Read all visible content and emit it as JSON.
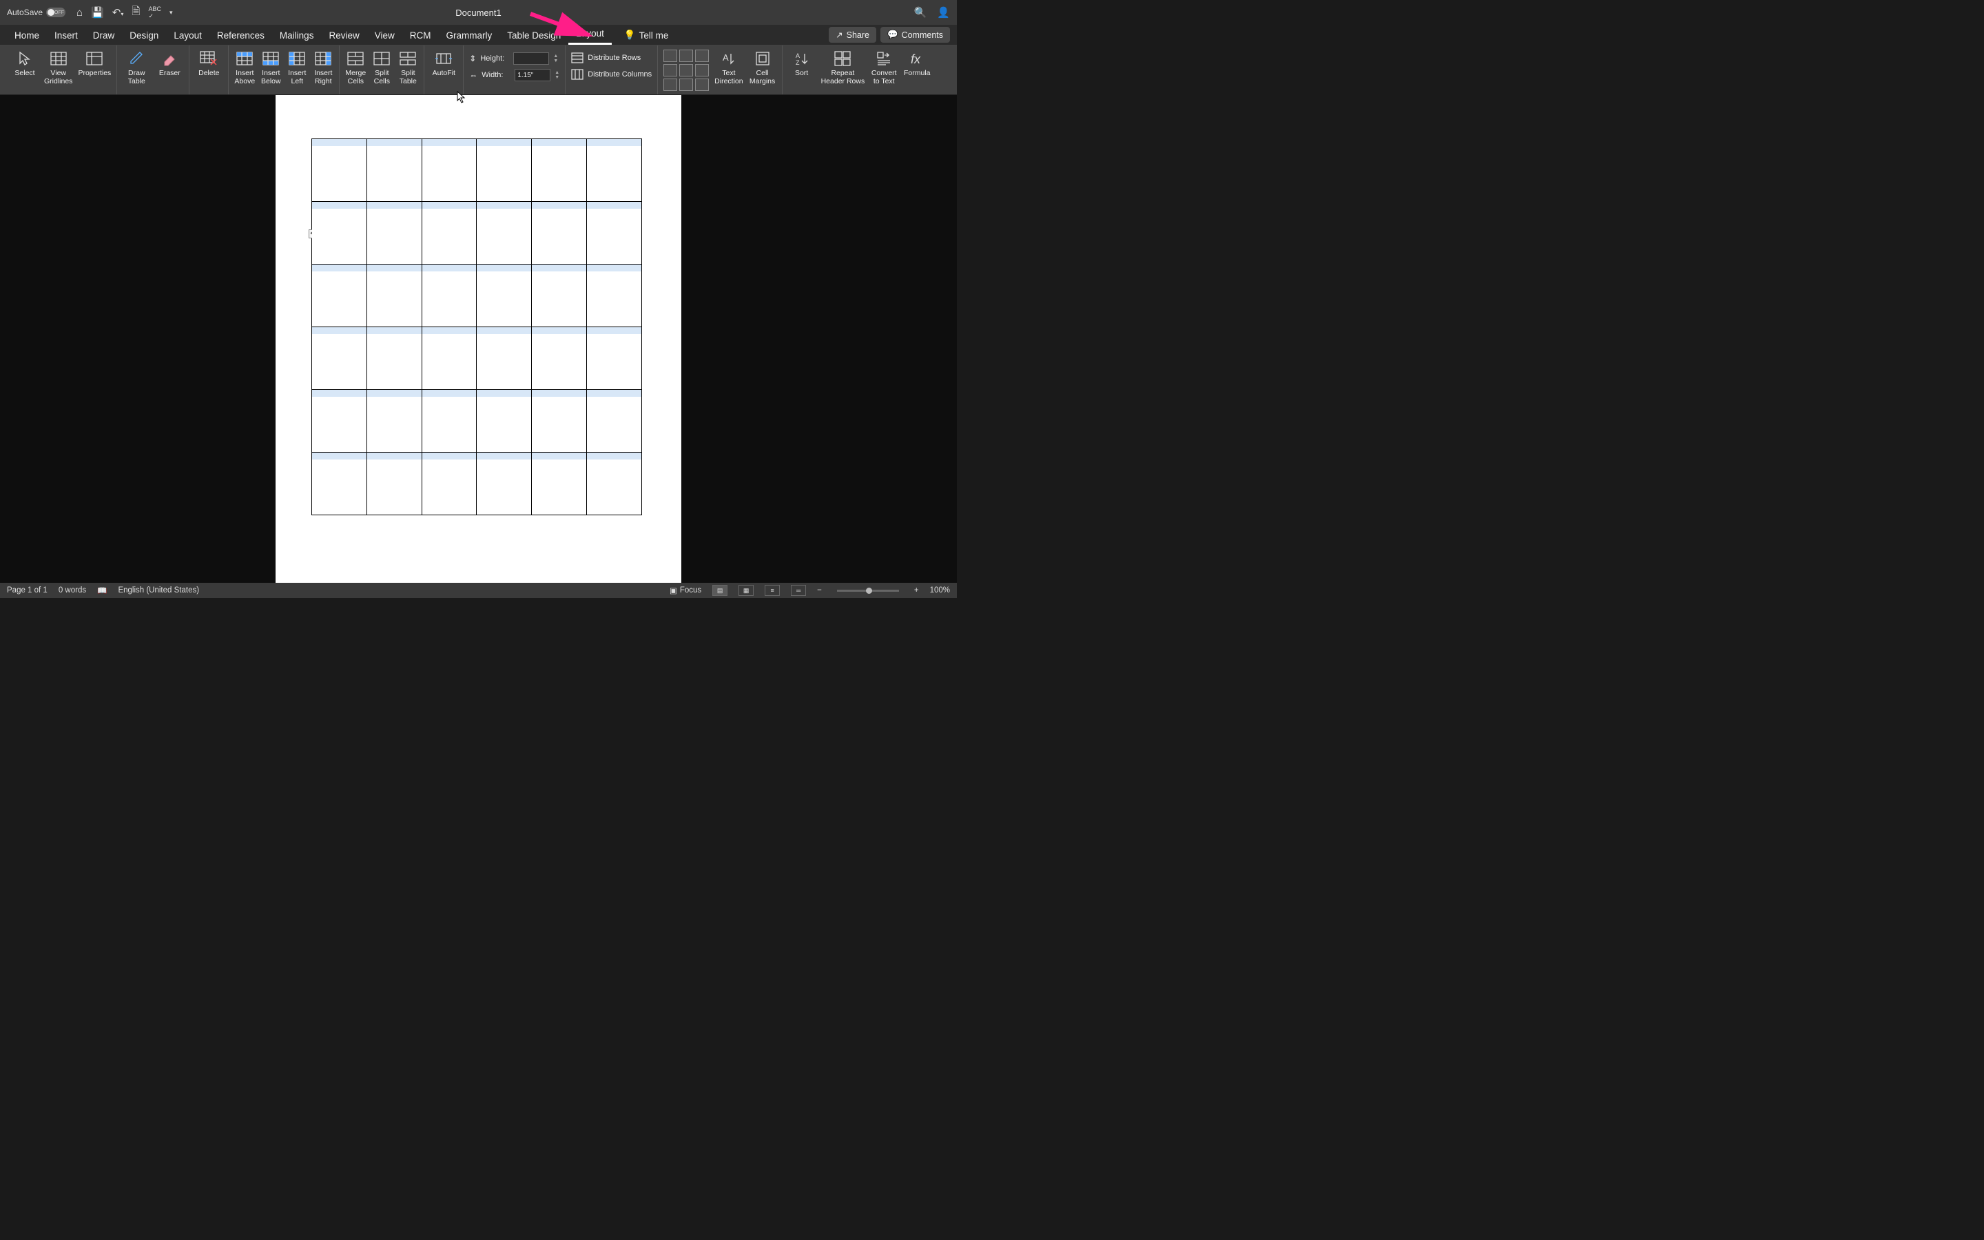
{
  "titlebar": {
    "autosave_label": "AutoSave",
    "autosave_state": "OFF",
    "document_title": "Document1"
  },
  "tabs": {
    "items": [
      "Home",
      "Insert",
      "Draw",
      "Design",
      "Layout",
      "References",
      "Mailings",
      "Review",
      "View",
      "RCM",
      "Grammarly",
      "Table Design",
      "Layout"
    ],
    "active_index": 12,
    "tell_me": "Tell me",
    "share": "Share",
    "comments": "Comments"
  },
  "ribbon": {
    "select": "Select",
    "view_gridlines": "View\nGridlines",
    "properties": "Properties",
    "draw_table": "Draw\nTable",
    "eraser": "Eraser",
    "delete": "Delete",
    "insert_above": "Insert\nAbove",
    "insert_below": "Insert\nBelow",
    "insert_left": "Insert\nLeft",
    "insert_right": "Insert\nRight",
    "merge_cells": "Merge\nCells",
    "split_cells": "Split\nCells",
    "split_table": "Split\nTable",
    "autofit": "AutoFit",
    "height_label": "Height:",
    "height_value": "",
    "width_label": "Width:",
    "width_value": "1.15\"",
    "dist_rows": "Distribute Rows",
    "dist_cols": "Distribute Columns",
    "text_direction": "Text\nDirection",
    "cell_margins": "Cell\nMargins",
    "sort": "Sort",
    "repeat_header": "Repeat\nHeader Rows",
    "convert_text": "Convert\nto Text",
    "formula": "Formula"
  },
  "document": {
    "table": {
      "rows": 6,
      "cols": 6
    }
  },
  "statusbar": {
    "page": "Page 1 of 1",
    "words": "0 words",
    "language": "English (United States)",
    "focus": "Focus",
    "zoom": "100%"
  }
}
